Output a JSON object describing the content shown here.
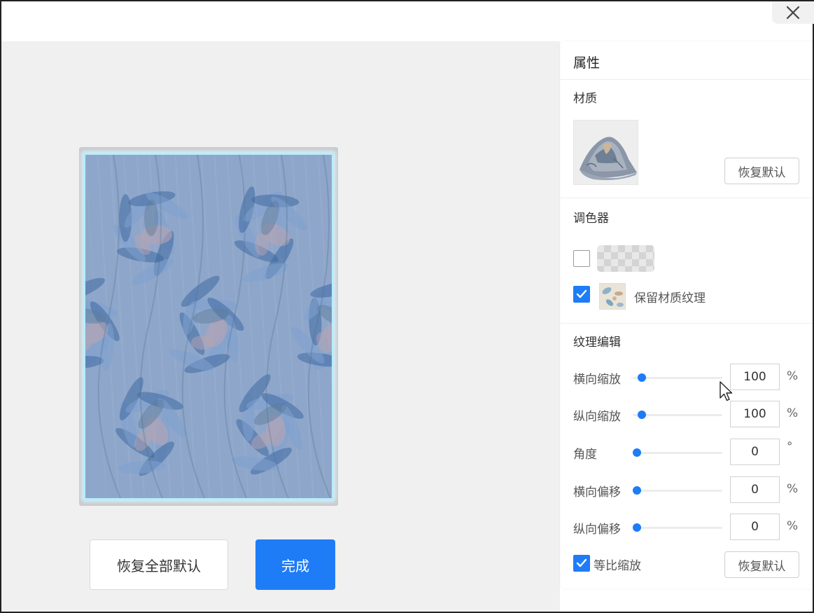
{
  "window": {
    "close_icon": "close-icon"
  },
  "canvas": {
    "background": "#f0f0f0",
    "fabric_colors": {
      "base": "#8ea6c9",
      "leaf_dark": "#3f6aa3",
      "leaf_light": "#7ea0cf",
      "flower": "#b7a3b2",
      "highlight": "#b6ecff"
    }
  },
  "actions": {
    "reset_all_label": "恢复全部默认",
    "done_label": "完成"
  },
  "panel": {
    "title": "属性",
    "material": {
      "title": "材质",
      "reset_label": "恢复默认"
    },
    "palette": {
      "title": "调色器",
      "transparent_checked": false,
      "keep_texture_checked": true,
      "keep_texture_label": "保留材质纹理"
    },
    "texture_edit": {
      "title": "纹理编辑",
      "rows": [
        {
          "label": "横向缩放",
          "value": "100",
          "unit": "%",
          "level": 0.06
        },
        {
          "label": "纵向缩放",
          "value": "100",
          "unit": "%",
          "level": 0.06
        },
        {
          "label": "角度",
          "value": "0",
          "unit": "°",
          "level": 0.0
        },
        {
          "label": "横向偏移",
          "value": "0",
          "unit": "%",
          "level": 0.0
        },
        {
          "label": "纵向偏移",
          "value": "0",
          "unit": "%",
          "level": 0.0
        }
      ],
      "proportional_checked": true,
      "proportional_label": "等比缩放",
      "reset_label": "恢复默认"
    }
  },
  "accent_color": "#1e7cf7"
}
